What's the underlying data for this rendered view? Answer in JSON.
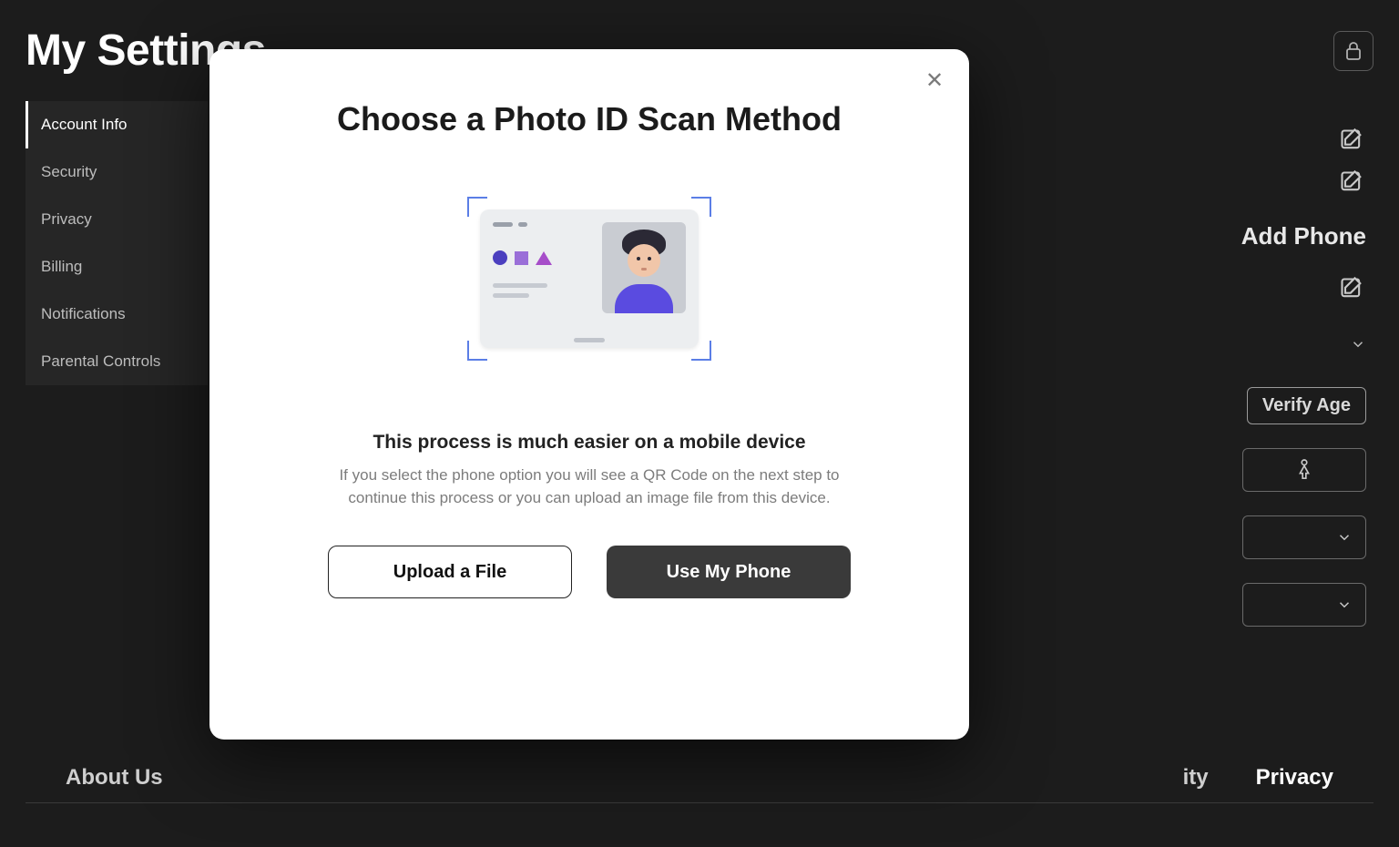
{
  "page": {
    "title": "My Settings"
  },
  "sidebar": {
    "items": [
      {
        "label": "Account Info"
      },
      {
        "label": "Security"
      },
      {
        "label": "Privacy"
      },
      {
        "label": "Billing"
      },
      {
        "label": "Notifications"
      },
      {
        "label": "Parental Controls"
      }
    ]
  },
  "right": {
    "add_phone": "Add Phone",
    "verify_age": "Verify Age"
  },
  "footer": {
    "about": "About Us",
    "middle_partial": "ity",
    "privacy": "Privacy"
  },
  "modal": {
    "title": "Choose a Photo ID Scan Method",
    "subtitle": "This process is much easier on a mobile device",
    "description": "If you select the phone option you will see a QR Code on the next step to continue this process or you can upload an image file from this device.",
    "upload_label": "Upload a File",
    "phone_label": "Use My Phone"
  }
}
